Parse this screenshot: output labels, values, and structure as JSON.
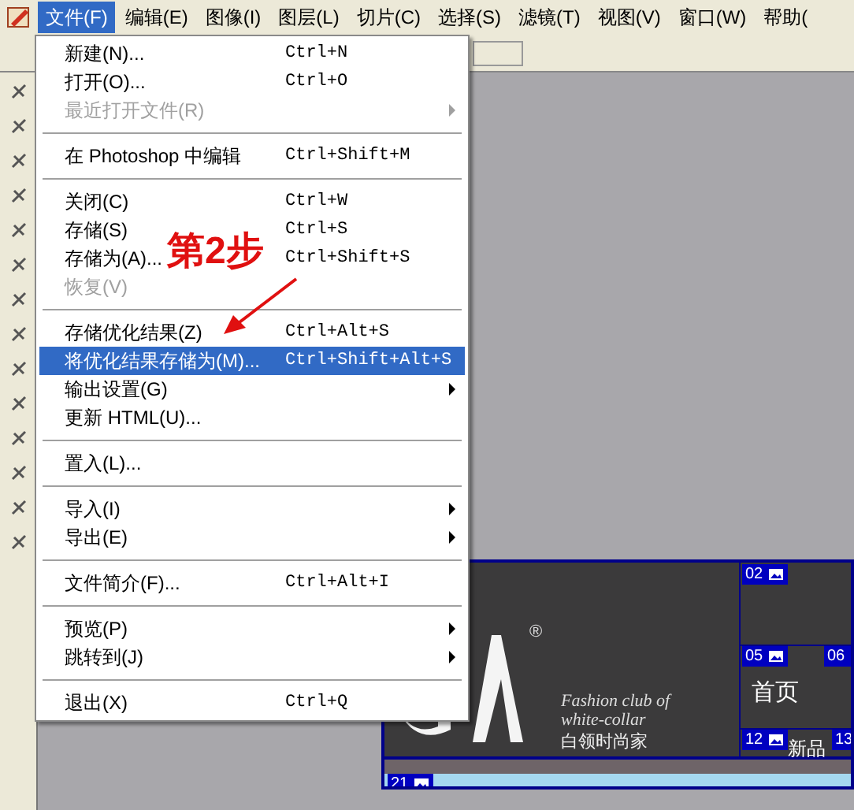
{
  "menu_bar": [
    {
      "label": "文件(F)",
      "selected": true
    },
    {
      "label": "编辑(E)",
      "selected": false
    },
    {
      "label": "图像(I)",
      "selected": false
    },
    {
      "label": "图层(L)",
      "selected": false
    },
    {
      "label": "切片(C)",
      "selected": false
    },
    {
      "label": "选择(S)",
      "selected": false
    },
    {
      "label": "滤镜(T)",
      "selected": false
    },
    {
      "label": "视图(V)",
      "selected": false
    },
    {
      "label": "窗口(W)",
      "selected": false
    },
    {
      "label": "帮助(",
      "selected": false
    }
  ],
  "file_menu": [
    {
      "kind": "item",
      "label": "新建(N)...",
      "shortcut": "Ctrl+N",
      "disabled": false,
      "submenu": false,
      "selected": false
    },
    {
      "kind": "item",
      "label": "打开(O)...",
      "shortcut": "Ctrl+O",
      "disabled": false,
      "submenu": false,
      "selected": false
    },
    {
      "kind": "item",
      "label": "最近打开文件(R)",
      "disabled": true,
      "submenu": true,
      "selected": false
    },
    {
      "kind": "separator"
    },
    {
      "kind": "item",
      "label": "在 Photoshop 中编辑",
      "shortcut": "Ctrl+Shift+M",
      "disabled": false,
      "submenu": false,
      "selected": false
    },
    {
      "kind": "separator"
    },
    {
      "kind": "item",
      "label": "关闭(C)",
      "shortcut": "Ctrl+W",
      "disabled": false,
      "submenu": false,
      "selected": false
    },
    {
      "kind": "item",
      "label": "存储(S)",
      "shortcut": "Ctrl+S",
      "disabled": false,
      "submenu": false,
      "selected": false
    },
    {
      "kind": "item",
      "label": "存储为(A)...",
      "shortcut": "Ctrl+Shift+S",
      "disabled": false,
      "submenu": false,
      "selected": false
    },
    {
      "kind": "item",
      "label": "恢复(V)",
      "disabled": true,
      "submenu": false,
      "selected": false
    },
    {
      "kind": "separator"
    },
    {
      "kind": "item",
      "label": "存储优化结果(Z)",
      "shortcut": "Ctrl+Alt+S",
      "disabled": false,
      "submenu": false,
      "selected": false
    },
    {
      "kind": "item",
      "label": "将优化结果存储为(M)...",
      "shortcut": "Ctrl+Shift+Alt+S",
      "disabled": false,
      "submenu": false,
      "selected": true
    },
    {
      "kind": "item",
      "label": "输出设置(G)",
      "disabled": false,
      "submenu": true,
      "selected": false
    },
    {
      "kind": "item",
      "label": "更新 HTML(U)...",
      "disabled": false,
      "submenu": false,
      "selected": false
    },
    {
      "kind": "separator"
    },
    {
      "kind": "item",
      "label": "置入(L)...",
      "disabled": false,
      "submenu": false,
      "selected": false
    },
    {
      "kind": "separator"
    },
    {
      "kind": "item",
      "label": "导入(I)",
      "disabled": false,
      "submenu": true,
      "selected": false
    },
    {
      "kind": "item",
      "label": "导出(E)",
      "disabled": false,
      "submenu": true,
      "selected": false
    },
    {
      "kind": "separator"
    },
    {
      "kind": "item",
      "label": "文件简介(F)...",
      "shortcut": "Ctrl+Alt+I",
      "disabled": false,
      "submenu": false,
      "selected": false
    },
    {
      "kind": "separator"
    },
    {
      "kind": "item",
      "label": "预览(P)",
      "disabled": false,
      "submenu": true,
      "selected": false
    },
    {
      "kind": "item",
      "label": "跳转到(J)",
      "disabled": false,
      "submenu": true,
      "selected": false
    },
    {
      "kind": "separator"
    },
    {
      "kind": "item",
      "label": "退出(X)",
      "shortcut": "Ctrl+Q",
      "disabled": false,
      "submenu": false,
      "selected": false
    }
  ],
  "annotation": {
    "label": "第2步"
  },
  "document": {
    "registered_mark": "®",
    "tagline": [
      "Fashion club of",
      "white-collar"
    ],
    "slogan": "白领时尚家",
    "nav": [
      {
        "label": "首页"
      },
      {
        "label": "新品"
      }
    ],
    "slices": [
      {
        "label": "02"
      },
      {
        "label": "05"
      },
      {
        "label": "06"
      },
      {
        "label": "12"
      },
      {
        "label": "13"
      },
      {
        "label": "21"
      }
    ]
  }
}
